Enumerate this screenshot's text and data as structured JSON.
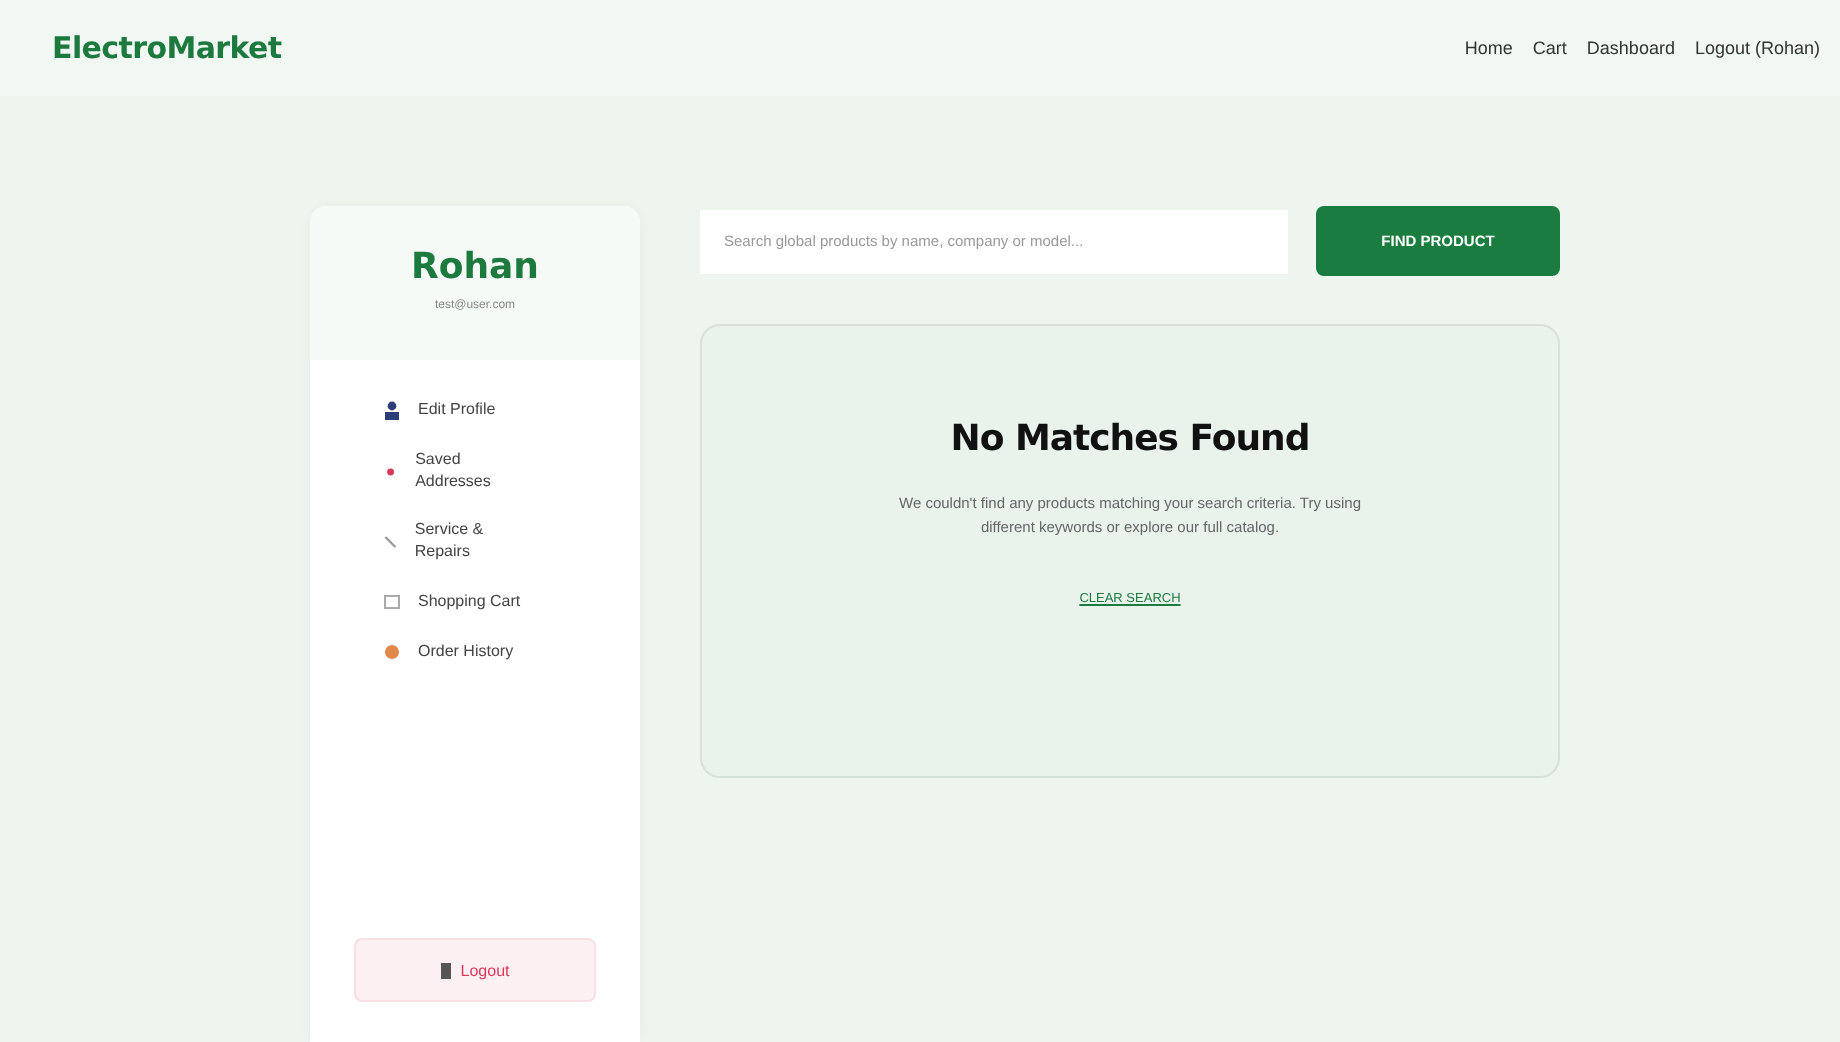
{
  "header": {
    "logo": "ElectroMarket",
    "nav": [
      "Home",
      "Cart",
      "Dashboard",
      "Logout (Rohan)"
    ]
  },
  "sidebar": {
    "name": "Rohan",
    "email": "test@user.com",
    "items": [
      {
        "label": "Edit Profile"
      },
      {
        "label": "Saved Addresses"
      },
      {
        "label": "Service & Repairs"
      },
      {
        "label": "Shopping Cart"
      },
      {
        "label": "Order History"
      }
    ],
    "logout": "Logout"
  },
  "search": {
    "placeholder": "Search global products by name, company or model...",
    "button": "FIND PRODUCT"
  },
  "empty_state": {
    "title": "No Matches Found",
    "message": "We couldn't find any products matching your search criteria. Try using different keywords or explore our full catalog.",
    "link": "CLEAR SEARCH"
  }
}
